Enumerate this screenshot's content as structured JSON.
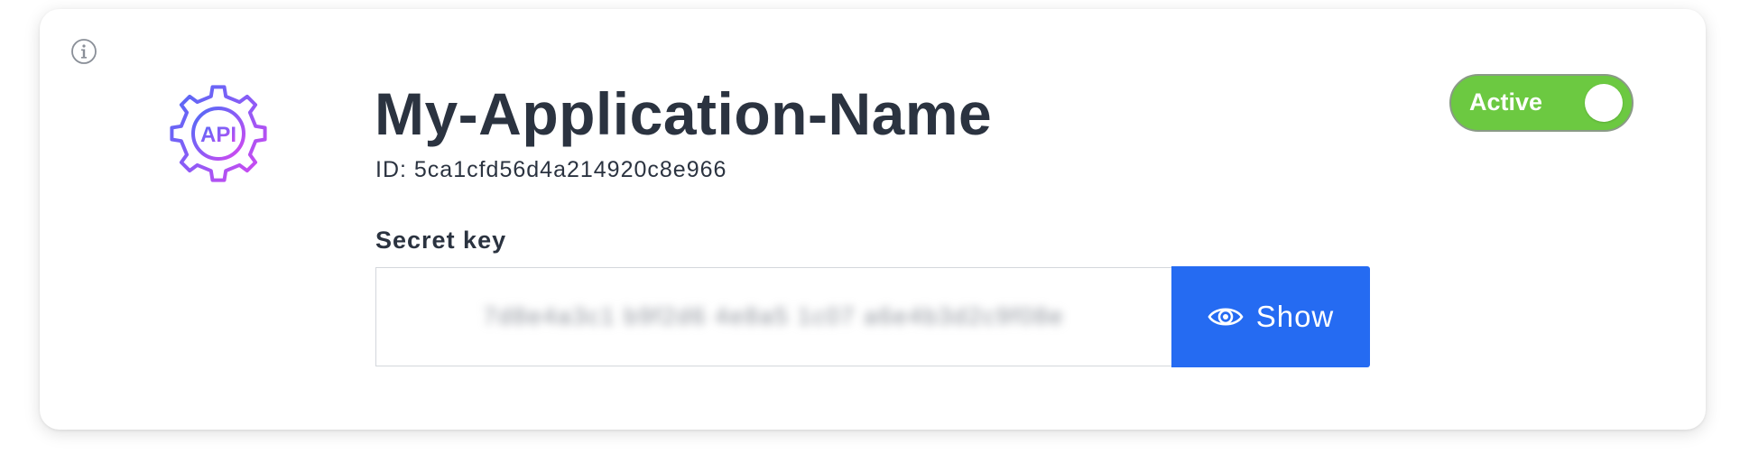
{
  "app": {
    "name": "My-Application-Name",
    "id_text": "ID: 5ca1cfd56d4a214920c8e966",
    "logo_text": "API",
    "logo_icon": "api-gear-icon"
  },
  "status": {
    "label": "Active",
    "enabled": true,
    "color": "#6cc941"
  },
  "secret_key": {
    "label": "Secret key",
    "masked_value": "7d8e4a3c1 b9f2d6 4e8a5 1c07 a6e4b3d2c9f08e",
    "show_label": "Show",
    "show_icon": "eye-icon",
    "button_color": "#256bf2"
  },
  "info": {
    "icon": "info-icon"
  }
}
